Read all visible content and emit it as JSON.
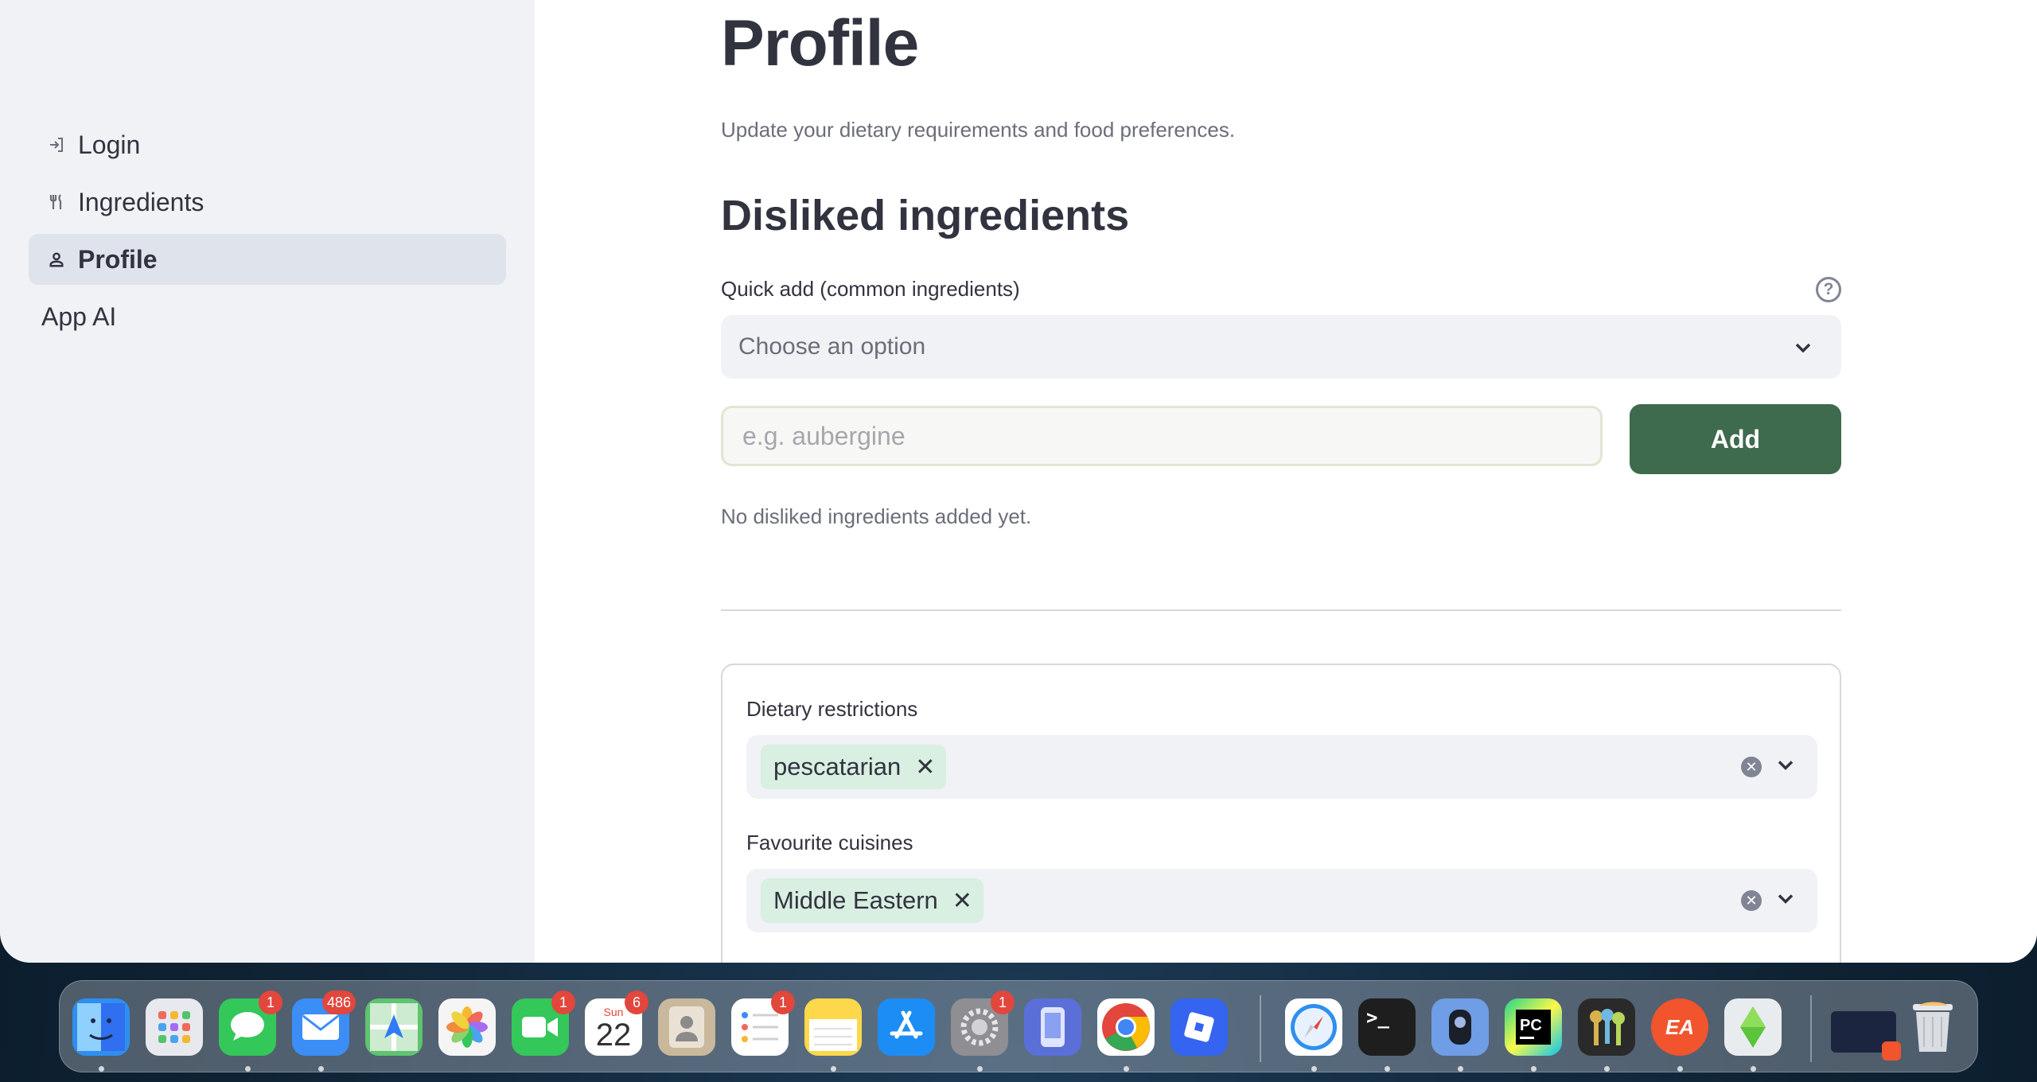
{
  "sidebar": {
    "items": [
      {
        "label": "Login",
        "icon": "login-icon",
        "active": false
      },
      {
        "label": "Ingredients",
        "icon": "fork-knife-icon",
        "active": false
      },
      {
        "label": "Profile",
        "icon": "person-icon",
        "active": true
      },
      {
        "label": "App AI",
        "icon": "",
        "active": false
      }
    ]
  },
  "main": {
    "title": "Profile",
    "subtitle": "Update your dietary requirements and food preferences.",
    "disliked": {
      "heading": "Disliked ingredients",
      "quick_add_label": "Quick add (common ingredients)",
      "quick_add_placeholder": "Choose an option",
      "input_placeholder": "e.g. aubergine",
      "add_label": "Add",
      "empty_message": "No disliked ingredients added yet."
    },
    "dietary": {
      "label": "Dietary restrictions",
      "selected": [
        "pescatarian"
      ]
    },
    "cuisines": {
      "label": "Favourite cuisines",
      "selected": [
        "Middle Eastern"
      ]
    }
  },
  "dock": {
    "apps": [
      {
        "name": "Finder",
        "icon": "finder-icon",
        "color": "#2f8ff0",
        "badge": ""
      },
      {
        "name": "Launchpad",
        "icon": "launchpad-icon",
        "color": "#e8e9ee",
        "badge": ""
      },
      {
        "name": "Messages",
        "icon": "messages-icon",
        "color": "#34c759",
        "badge": "1"
      },
      {
        "name": "Mail",
        "icon": "mail-icon",
        "color": "#3a8ef6",
        "badge": "486"
      },
      {
        "name": "Maps",
        "icon": "maps-icon",
        "color": "#5ec46f",
        "badge": ""
      },
      {
        "name": "Photos",
        "icon": "photos-icon",
        "color": "#f5f5f5",
        "badge": ""
      },
      {
        "name": "FaceTime",
        "icon": "facetime-icon",
        "color": "#34c759",
        "badge": "1"
      },
      {
        "name": "Calendar",
        "icon": "calendar-icon",
        "color": "#ffffff",
        "badge": "6",
        "day": "22",
        "weekday": "Sun"
      },
      {
        "name": "Contacts",
        "icon": "contacts-icon",
        "color": "#c9b89c",
        "badge": ""
      },
      {
        "name": "Reminders",
        "icon": "reminders-icon",
        "color": "#ffffff",
        "badge": "1"
      },
      {
        "name": "Notes",
        "icon": "notes-icon",
        "color": "#fdd84a",
        "badge": ""
      },
      {
        "name": "App Store",
        "icon": "app-store-icon",
        "color": "#1c8df5",
        "badge": ""
      },
      {
        "name": "System Settings",
        "icon": "settings-icon",
        "color": "#8e8e93",
        "badge": "1"
      },
      {
        "name": "Simulator",
        "icon": "simulator-icon",
        "color": "#5a6fd8",
        "badge": ""
      },
      {
        "name": "Chrome",
        "icon": "chrome-icon",
        "color": "#ffffff",
        "badge": ""
      },
      {
        "name": "Roblox",
        "icon": "roblox-icon",
        "color": "#3564f0",
        "badge": ""
      },
      {
        "name": "Safari",
        "icon": "safari-icon",
        "color": "#ffffff",
        "badge": ""
      },
      {
        "name": "Terminal",
        "icon": "terminal-icon",
        "color": "#1e1e1e",
        "badge": ""
      },
      {
        "name": "Ollama",
        "icon": "ollama-icon",
        "color": "#6f9de6",
        "badge": ""
      },
      {
        "name": "PyCharm",
        "icon": "pycharm-icon",
        "color": "#21d789",
        "badge": ""
      },
      {
        "name": "Keychain",
        "icon": "keychain-icon",
        "color": "#2a2a2a",
        "badge": ""
      },
      {
        "name": "EA",
        "icon": "ea-icon",
        "color": "#f2542d",
        "badge": ""
      },
      {
        "name": "The Sims",
        "icon": "sims-icon",
        "color": "#e9ecef",
        "badge": ""
      },
      {
        "name": "Recent",
        "icon": "recent-window-icon",
        "color": "#1c2540",
        "badge": ""
      },
      {
        "name": "Trash",
        "icon": "trash-icon",
        "color": "#d9dde2",
        "badge": ""
      }
    ]
  }
}
